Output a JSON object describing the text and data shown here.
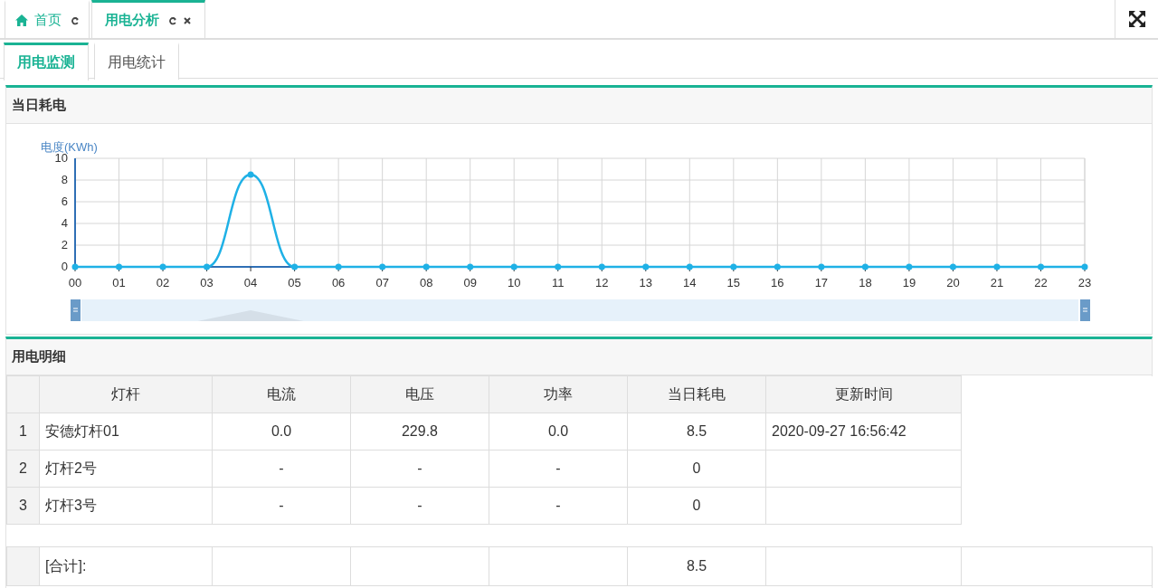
{
  "tab_bar": {
    "tabs": [
      {
        "label": "首页",
        "kind": "home",
        "selected": false,
        "closable": false
      },
      {
        "label": "用电分析",
        "kind": "page",
        "selected": true,
        "closable": true
      }
    ]
  },
  "sub_tabs": [
    {
      "label": "用电监测",
      "selected": true
    },
    {
      "label": "用电统计",
      "selected": false
    }
  ],
  "consumption_panel": {
    "title": "当日耗电",
    "chart_data": {
      "type": "line",
      "ylabel": "电度(KWh)",
      "categories": [
        "00",
        "01",
        "02",
        "03",
        "04",
        "05",
        "06",
        "07",
        "08",
        "09",
        "10",
        "11",
        "12",
        "13",
        "14",
        "15",
        "16",
        "17",
        "18",
        "19",
        "20",
        "21",
        "22",
        "23"
      ],
      "values": [
        0,
        0,
        0,
        0,
        8.5,
        0,
        0,
        0,
        0,
        0,
        0,
        0,
        0,
        0,
        0,
        0,
        0,
        0,
        0,
        0,
        0,
        0,
        0,
        0
      ],
      "ylim": [
        0,
        10
      ],
      "yticks": [
        0,
        2,
        4,
        6,
        8,
        10
      ],
      "grid": true,
      "marker": true
    }
  },
  "detail_panel": {
    "title": "用电明细",
    "table": {
      "columns": [
        "灯杆",
        "电流",
        "电压",
        "功率",
        "当日耗电",
        "更新时间"
      ],
      "rows": [
        {
          "index": "1",
          "cells": [
            "安德灯杆01",
            "0.0",
            "229.8",
            "0.0",
            "8.5",
            "2020-09-27 16:56:42"
          ]
        },
        {
          "index": "2",
          "cells": [
            "灯杆2号",
            "-",
            "-",
            "-",
            "0",
            null
          ]
        },
        {
          "index": "3",
          "cells": [
            "灯杆3号",
            "-",
            "-",
            "-",
            "0",
            null
          ]
        }
      ],
      "total": {
        "label": "[合计]:",
        "daily_consumption": "8.5"
      }
    }
  }
}
